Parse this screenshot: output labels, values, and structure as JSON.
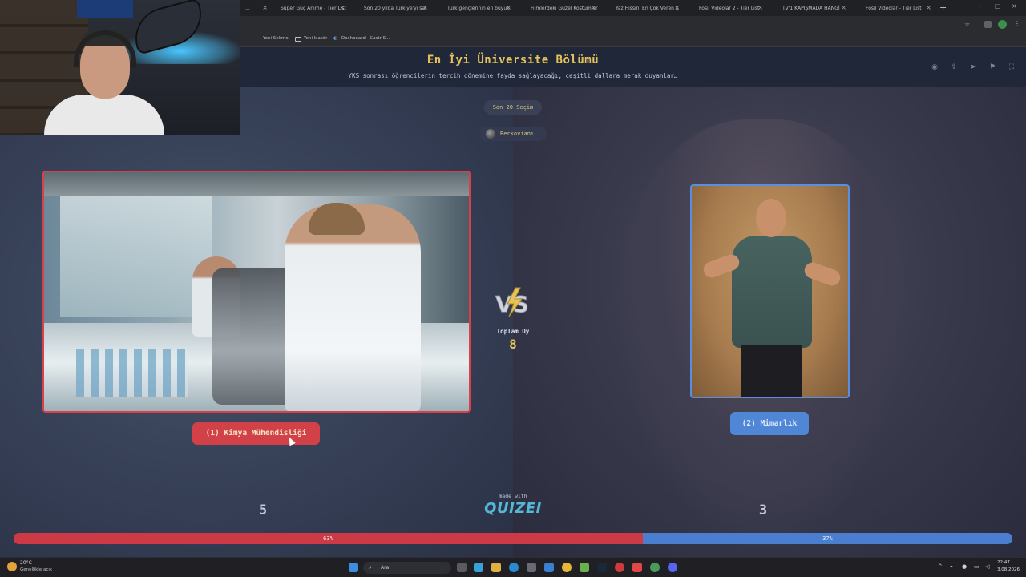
{
  "browser": {
    "tabs": [
      {
        "label": "Süper Güç Anime - Tier List"
      },
      {
        "label": "Son 20 yılda Türkiye'yi sal"
      },
      {
        "label": "Türk gençlerinin en büyük"
      },
      {
        "label": "Filmlerdeki Güzel Kostümler"
      },
      {
        "label": "Yaz Hissini En Çok Veren Ş"
      },
      {
        "label": "Fosil Videolar 2 - Tier List"
      },
      {
        "label": "TV'1 KAPIŞMADA HANGİ"
      },
      {
        "label": "Fosil Videolar - Tier List"
      }
    ],
    "bookmarks": [
      "Yeni Sekme",
      "Yeni klasör",
      "Dashboard - Castr S..."
    ]
  },
  "header": {
    "title": "En İyi Üniversite Bölümü",
    "subtitle": "YKS sonrası öğrencilerin tercih dönemine fayda sağlayacağı, çeşitli dallara merak duyanlar…"
  },
  "round": {
    "label": "Son 20 Seçim"
  },
  "author": {
    "name": "Berkovianı"
  },
  "left": {
    "label": "(1) Kimya Mühendisliği",
    "votes": "5",
    "percent_label": "63%",
    "percent": 63
  },
  "right": {
    "label": "(2) Mimarlık",
    "votes": "3",
    "percent_label": "37%",
    "percent": 37
  },
  "center": {
    "vs": "VS",
    "total_label": "Toplam Oy",
    "total_value": "8"
  },
  "footer": {
    "made_with": "made with",
    "brand": "QUIZEI"
  },
  "taskbar": {
    "temp": "20°C",
    "weather": "Genellikle açık",
    "search_placeholder": "Ara",
    "time": "22:47",
    "date": "3.08.2026"
  },
  "colors": {
    "gold": "#e6c35a",
    "red": "#cc3b45",
    "blue": "#4a7fd0",
    "brand": "#56b6d6"
  }
}
